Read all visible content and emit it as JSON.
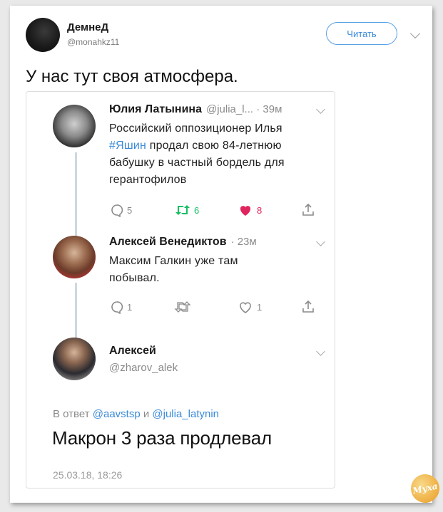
{
  "author": {
    "name": "ДемнеД",
    "handle": "@monahkz11"
  },
  "follow_button": "Читать",
  "tweet_text": "У нас тут своя атмосфера.",
  "thread": [
    {
      "name": "Юлия Латынина",
      "meta": "@julia_l... · 39м",
      "text_line1": "Российский оппозиционер Илья",
      "hashtag": "#Яшин",
      "text_line2_rest": " продал свою 84-летнюю",
      "text_line3": "бабушку в частный бордель для",
      "text_line4": "герантофилов",
      "replies": "5",
      "retweets": "6",
      "likes": "8"
    },
    {
      "name": "Алексей Венедиктов",
      "meta": "· 23м",
      "text_line1": "Максим Галкин уже там",
      "text_line2": "побывал.",
      "replies": "1",
      "retweets": "",
      "likes": "1"
    },
    {
      "name": "Алексей",
      "handle": "@zharov_alek"
    }
  ],
  "reply_to": {
    "prefix": "В ответ ",
    "user1": "@aavstsp",
    "joiner": " и ",
    "user2": "@julia_latynin"
  },
  "reply_text": "Макрон 3 раза продлевал",
  "timestamp": "25.03.18, 18:26",
  "logo_text": "Муха",
  "colors": {
    "accent": "#3b8ad8",
    "like": "#e0245e",
    "retweet": "#17bf63"
  }
}
